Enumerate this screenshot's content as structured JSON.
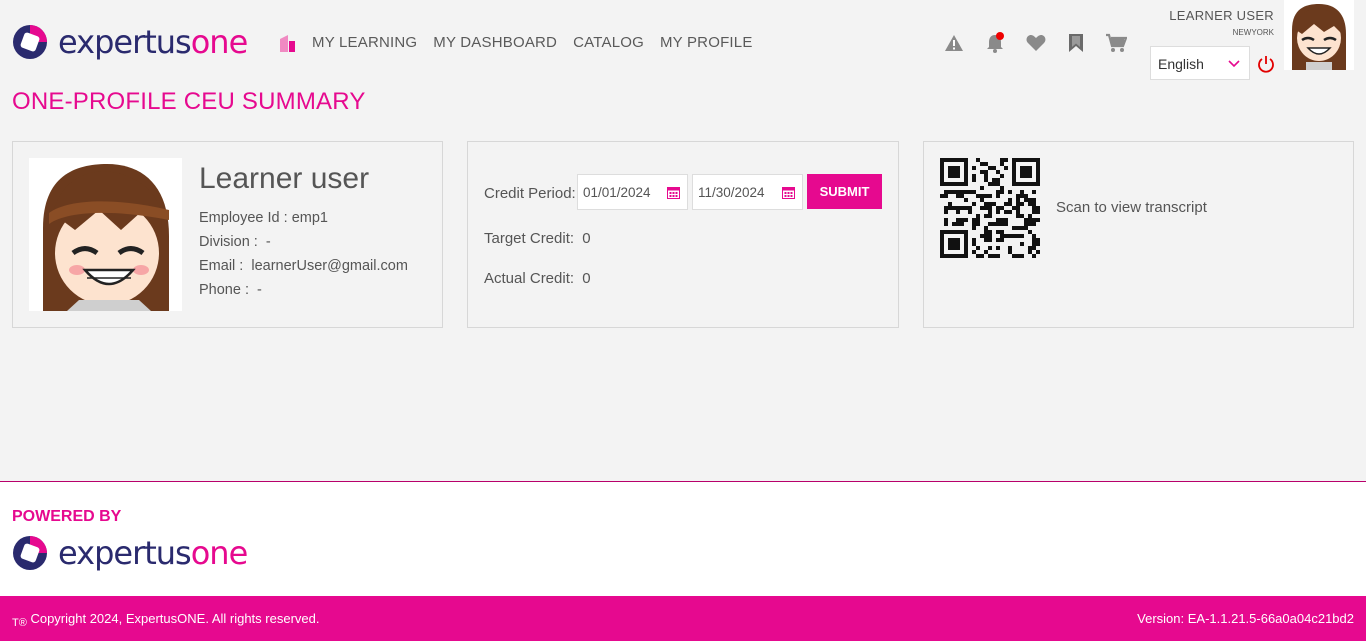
{
  "brand": {
    "name_part1": "expertus",
    "name_part2": "one",
    "accent": "#e6098f",
    "dark": "#2a2a6e"
  },
  "nav": {
    "items": [
      "MY LEARNING",
      "MY DASHBOARD",
      "CATALOG",
      "MY PROFILE"
    ]
  },
  "header_icons": [
    "alert-icon",
    "bell-icon",
    "heart-icon",
    "bookmark-icon",
    "cart-icon"
  ],
  "user": {
    "name": "LEARNER USER",
    "location": "NEWYORK"
  },
  "language": {
    "selected": "English"
  },
  "page_title": "ONE-PROFILE CEU SUMMARY",
  "profile": {
    "name": "Learner user",
    "employee_id_label": "Employee Id :",
    "employee_id": "emp1",
    "division_label": "Division :",
    "division": "-",
    "email_label": "Email :",
    "email": "learnerUser@gmail.com",
    "phone_label": "Phone :",
    "phone": "-"
  },
  "credit": {
    "period_label": "Credit Period:",
    "start_date": "01/01/2024",
    "end_date": "11/30/2024",
    "submit_label": "SUBMIT",
    "target_label": "Target Credit:",
    "target_value": "0",
    "actual_label": "Actual Credit:",
    "actual_value": "0"
  },
  "qr": {
    "caption": "Scan to view transcript"
  },
  "footer": {
    "powered_by": "POWERED BY",
    "copyright": "Copyright 2024, ExpertusONE. All rights reserved.",
    "version": "Version: EA-1.1.21.5-66a0a04c21bd2"
  }
}
